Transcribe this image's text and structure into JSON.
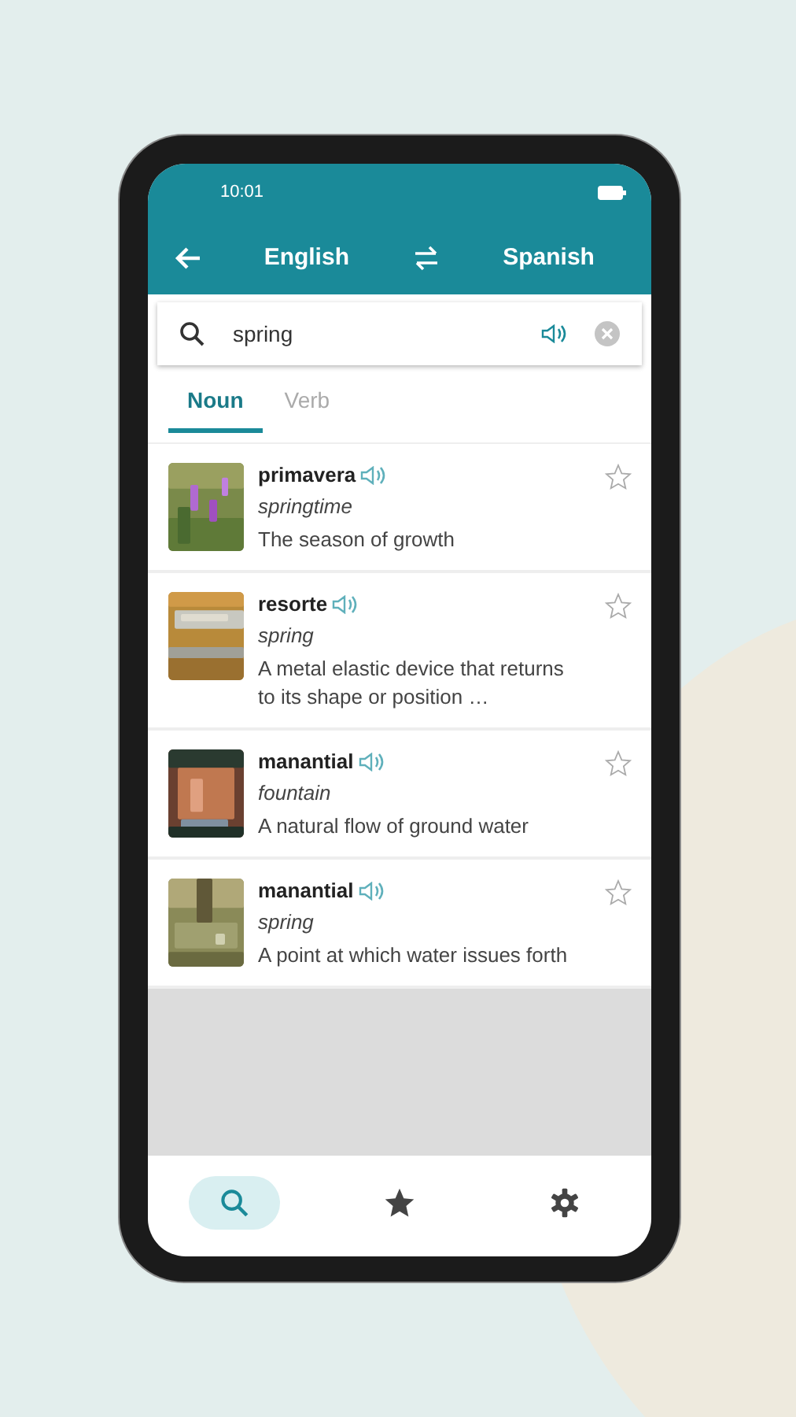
{
  "status_bar": {
    "time": "10:01"
  },
  "header": {
    "source_language": "English",
    "target_language": "Spanish"
  },
  "search": {
    "value": "spring"
  },
  "tabs": [
    {
      "label": "Noun",
      "selected": true
    },
    {
      "label": "Verb",
      "selected": false
    }
  ],
  "entries": [
    {
      "word": "primavera",
      "translation": "springtime",
      "definition": "The season of growth",
      "favorite": false
    },
    {
      "word": "resorte",
      "translation": "spring",
      "definition": "A metal elastic device that returns to its shape or position …",
      "favorite": false
    },
    {
      "word": "manantial",
      "translation": "fountain",
      "definition": "A natural flow of ground water",
      "favorite": false
    },
    {
      "word": "manantial",
      "translation": "spring",
      "definition": "A point at which water issues forth",
      "favorite": false
    }
  ],
  "nav": [
    {
      "kind": "search",
      "selected": true
    },
    {
      "kind": "favorites",
      "selected": false
    },
    {
      "kind": "settings",
      "selected": false
    }
  ]
}
